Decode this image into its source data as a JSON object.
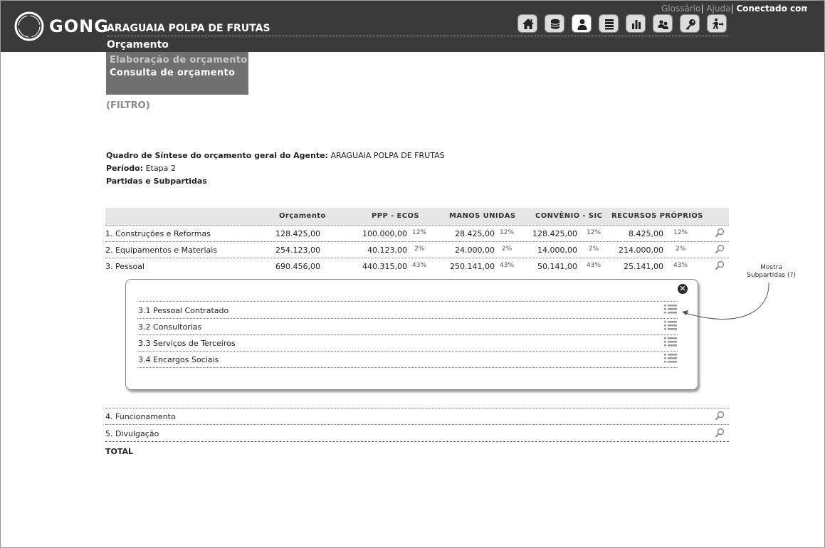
{
  "header": {
    "brand": "GONG",
    "org_name": "ARAGUAIA POLPA DE FRUTAS",
    "section": "Orçamento",
    "links": {
      "glossario": "Glossário",
      "ajuda": "Ajuda",
      "sep": "|",
      "conectado": "Conectado como:",
      "user": ","
    },
    "toolbar": [
      {
        "icon": "home-icon",
        "active": false
      },
      {
        "icon": "database-icon",
        "active": false
      },
      {
        "icon": "user-icon",
        "active": true
      },
      {
        "icon": "stack-icon",
        "active": false
      },
      {
        "icon": "bar-chart-icon",
        "active": false
      },
      {
        "icon": "users-icon",
        "active": false
      },
      {
        "icon": "key-icon",
        "active": false
      },
      {
        "icon": "exit-icon",
        "active": false
      }
    ]
  },
  "submenu": {
    "items": [
      {
        "label": "Elaboração de orçamento",
        "color": "#c8c8c8"
      },
      {
        "label": "Consulta de orçamento",
        "color": "#ffffff"
      }
    ]
  },
  "filtro": "(FILTRO)",
  "info": {
    "quadro_label": "Quadro de Síntese do orçamento geral do Agente:",
    "quadro_value": "ARAGUAIA POLPA DE FRUTAS",
    "periodo_label": "Período:",
    "periodo_value": "Etapa 2",
    "partidas": "Partidas e Subpartidas"
  },
  "table": {
    "headers": [
      "Orçamento",
      "PPP - ECOS",
      "MANOS UNIDAS",
      "CONVÊNIO - SIC",
      "RECURSOS PRÓPRIOS"
    ],
    "rows": [
      {
        "label": "1. Construções e Reformas",
        "orcamento": "128.425,00",
        "ppp": "100.000,00",
        "ppp_pct": "12%",
        "manos": "28.425,00",
        "manos_pct": "12%",
        "convenio": "128.425,00",
        "convenio_pct": "12%",
        "recursos": "8.425,00",
        "recursos_pct": "12%"
      },
      {
        "label": "2. Equipamentos e Materiais",
        "orcamento": "254.123,00",
        "ppp": "40.123,00",
        "ppp_pct": "2%",
        "manos": "24.000,00",
        "manos_pct": "2%",
        "convenio": "14.000,00",
        "convenio_pct": "2%",
        "recursos": "214.000,00",
        "recursos_pct": "2%"
      },
      {
        "label": "3. Pessoal",
        "orcamento": "690.456,00",
        "ppp": "440.315,00",
        "ppp_pct": "43%",
        "manos": "250.141,00",
        "manos_pct": "43%",
        "convenio": "50.141,00",
        "convenio_pct": "43%",
        "recursos": "25.141,00",
        "recursos_pct": "43%"
      }
    ],
    "subpartidas": [
      {
        "label": "3.1 Pessoal Contratado"
      },
      {
        "label": "3.2 Consultorias"
      },
      {
        "label": "3.3 Serviços de Terceiros"
      },
      {
        "label": "3.4 Encargos Sociais"
      }
    ],
    "rows_after": [
      {
        "label": "4. Funcionamento"
      },
      {
        "label": "5. Divulgação"
      }
    ],
    "total": "TOTAL"
  },
  "annotation": {
    "line1": "Mostra",
    "line2": "Subpartidas (?)"
  }
}
